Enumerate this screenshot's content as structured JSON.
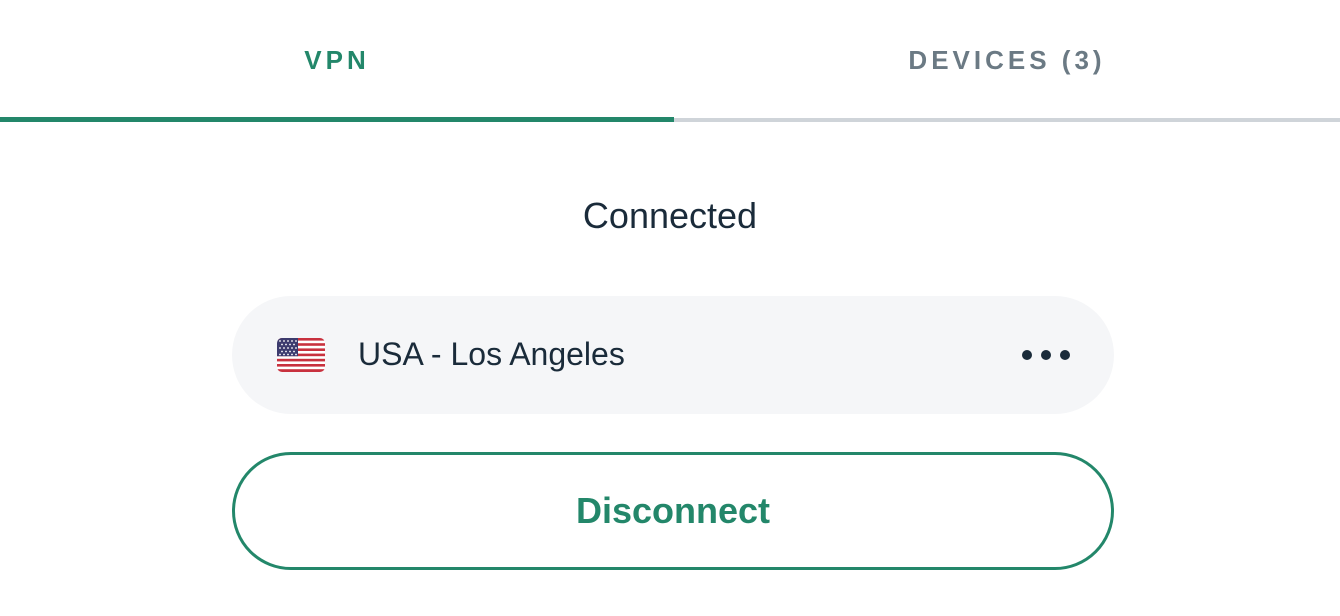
{
  "tabs": {
    "vpn": {
      "label": "VPN",
      "active": true
    },
    "devices": {
      "label": "DEVICES (3)",
      "active": false
    }
  },
  "status": {
    "text": "Connected"
  },
  "location": {
    "name": "USA - Los Angeles",
    "flag_icon": "us-flag-icon",
    "more_icon": "more-options-icon"
  },
  "actions": {
    "disconnect_label": "Disconnect"
  },
  "colors": {
    "accent": "#23876a",
    "inactive_tab_text": "#6b7a84",
    "inactive_underline": "#cfd4d9",
    "text": "#1a2b3a",
    "pill_background": "#f5f6f8"
  }
}
